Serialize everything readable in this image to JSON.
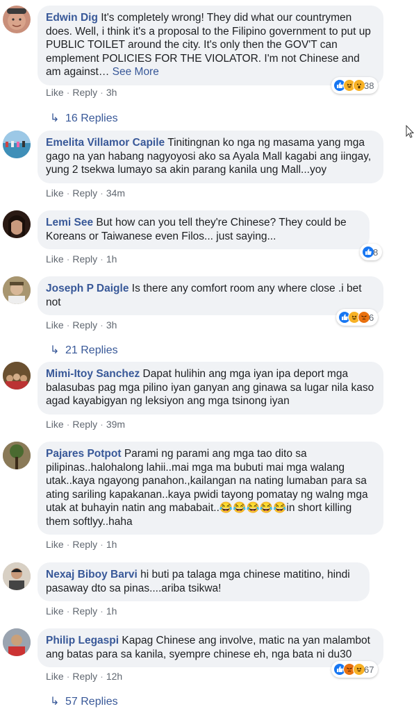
{
  "comments": [
    {
      "author": "Edwin Dig",
      "text": "It's completely wrong! They did what our countrymen does. Well, i think it's a proposal to the Filipino government to put up PUBLIC TOILET around the city. It's only then the GOV'T can emplement POLICIES FOR THE VIOLATOR. I'm not Chinese and am against… ",
      "see_more": "See More",
      "like": "Like",
      "reply": "Reply",
      "time": "3h",
      "reactions": [
        "like",
        "haha",
        "wow"
      ],
      "reaction_count": "38",
      "replies": "16 Replies",
      "avatar_color": "#c98f7a"
    },
    {
      "author": "Emelita Villamor Capile",
      "text": "Tinitingnan ko nga ng masama yang mga gago na yan habang nagyoyosi ako sa Ayala Mall kagabi ang iingay, yung 2 tsekwa lumayo sa akin parang kanila ung Mall...yoy",
      "like": "Like",
      "reply": "Reply",
      "time": "34m",
      "avatar_color": "#5a9fc4"
    },
    {
      "author": "Lemi See",
      "text": "But how can you tell they're Chinese? They could be Koreans or Taiwanese even Filos... just saying...",
      "like": "Like",
      "reply": "Reply",
      "time": "1h",
      "reactions": [
        "like"
      ],
      "reaction_count": "8",
      "avatar_color": "#5b3a2e"
    },
    {
      "author": "Joseph P Daigle",
      "text": "Is there any comfort room any where close .i bet not",
      "like": "Like",
      "reply": "Reply",
      "time": "3h",
      "reactions": [
        "like",
        "haha",
        "angry"
      ],
      "reaction_count": "6",
      "replies": "21 Replies",
      "avatar_color": "#8c7a5c"
    },
    {
      "author": "Mimi-Itoy Sanchez",
      "text": "Dapat hulihin ang mga iyan ipa deport mga balasubas pag mga pilino iyan ganyan ang ginawa sa lugar nila kaso agad kayabigyan ng leksiyon ang mga tsinong iyan",
      "like": "Like",
      "reply": "Reply",
      "time": "39m",
      "avatar_color": "#7a6040"
    },
    {
      "author": "Pajares Potpot",
      "text": "Parami ng parami ang mga tao dito sa pilipinas..halohalong lahii..mai mga ma bubuti mai mga walang utak..kaya ngayong panahon.,kailangan na nating lumaban para sa ating sariling kapakanan..kaya pwidi tayong pomatay ng walng mga utak at buhayin natin ang mababait..😂😂😂😂😂in short killing them softlyy..haha",
      "like": "Like",
      "reply": "Reply",
      "time": "1h",
      "avatar_color": "#6b5b3e"
    },
    {
      "author": "Nexaj Biboy Barvi",
      "text": "hi buti pa talaga mga chinese matitino, hindi pasaway dto sa pinas....ariba tsikwa!",
      "like": "Like",
      "reply": "Reply",
      "time": "1h",
      "avatar_color": "#b0a090"
    },
    {
      "author": "Philip Legaspi",
      "text": "Kapag Chinese ang involve, matic na yan malambot ang batas para sa kanila, syempre chinese eh, nga bata ni du30",
      "like": "Like",
      "reply": "Reply",
      "time": "12h",
      "reactions": [
        "like",
        "angry",
        "haha"
      ],
      "reaction_count": "67",
      "replies": "57 Replies",
      "avatar_color": "#7f8a99"
    }
  ],
  "colors": {
    "link": "#385898",
    "bubble": "#f0f2f5",
    "meta": "#606770"
  }
}
